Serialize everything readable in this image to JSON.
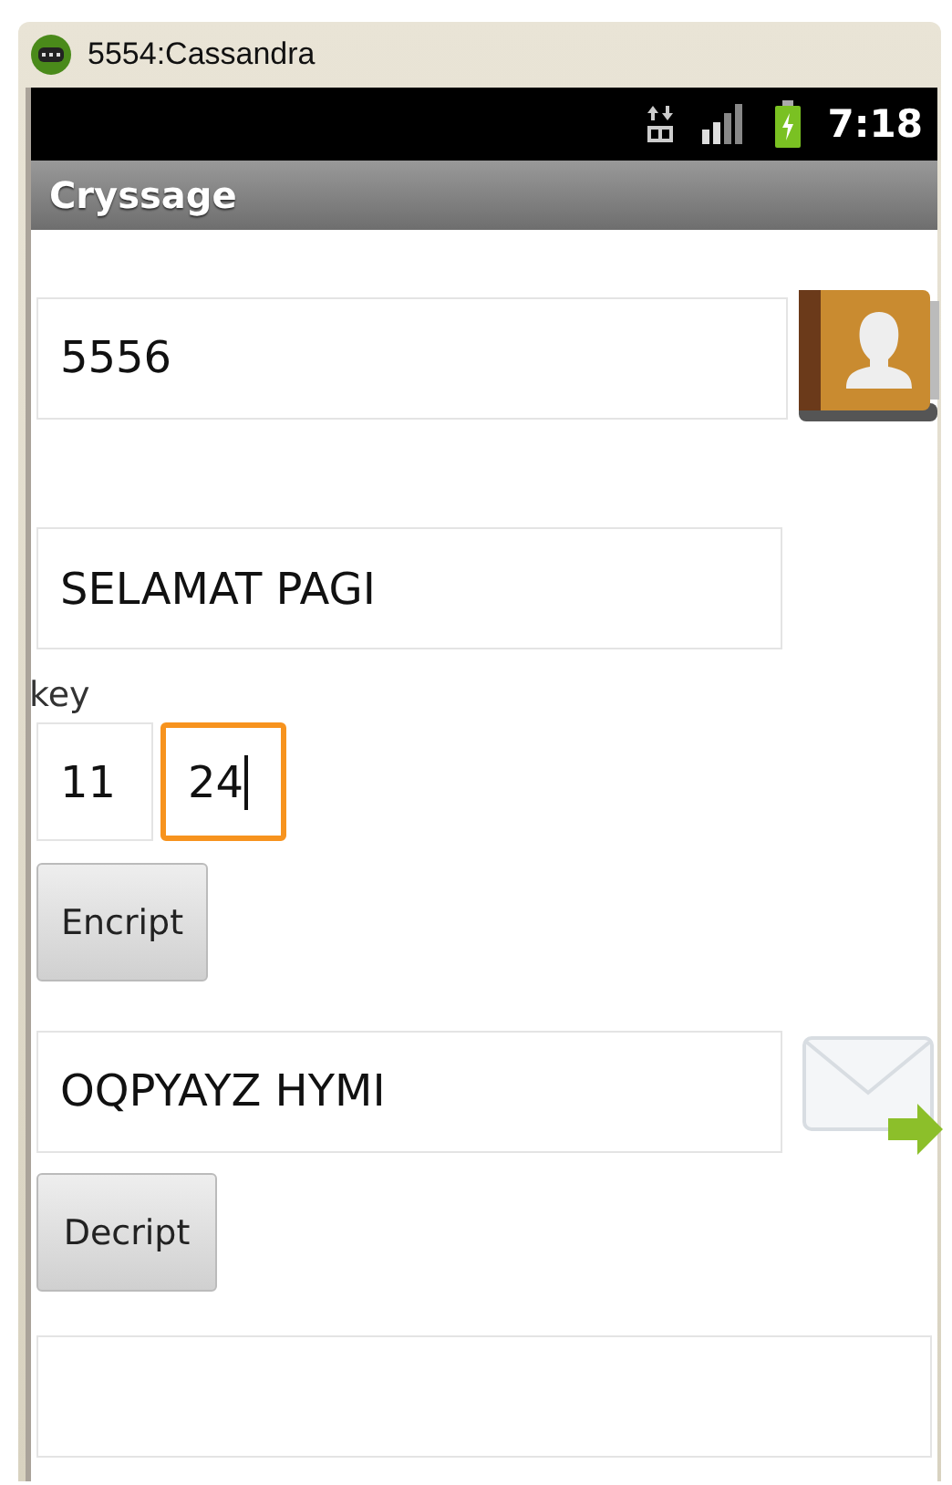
{
  "window": {
    "title": "5554:Cassandra"
  },
  "status_bar": {
    "time": "7:18"
  },
  "app_bar": {
    "title": "Cryssage"
  },
  "recipient_field": {
    "value": "5556"
  },
  "message_field": {
    "value": "SELAMAT PAGI"
  },
  "key_label": "key",
  "key_fields": [
    {
      "value": "11",
      "focused": false
    },
    {
      "value": "24",
      "focused": true
    }
  ],
  "encrypt_button": "Encript",
  "cipher_field": {
    "value": "OQPYAYZ HYMI"
  },
  "decrypt_button": "Decript"
}
